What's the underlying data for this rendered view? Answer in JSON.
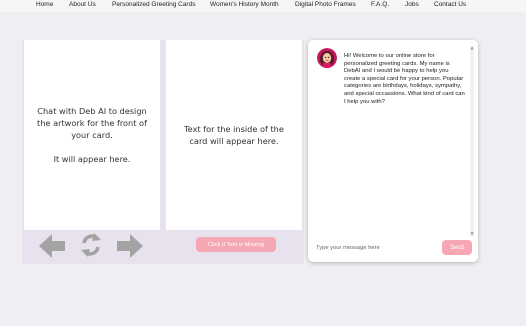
{
  "nav": {
    "items": [
      {
        "label": "Home"
      },
      {
        "label": "About Us"
      },
      {
        "label": "Personalized Greeting Cards"
      },
      {
        "label": "Women's History Month"
      },
      {
        "label": "Digital Photo Frames"
      },
      {
        "label": "F.A.Q."
      },
      {
        "label": "Jobs"
      },
      {
        "label": "Contact Us"
      }
    ]
  },
  "card_front": {
    "text": "Chat with Deb AI to design\nthe artwork for the front of\nyour card.\n\nIt will appear here."
  },
  "card_inside": {
    "text": "Text for the inside of the\ncard will appear here."
  },
  "controls": {
    "back_icon": "arrow-left-icon",
    "refresh_icon": "refresh-icon",
    "forward_icon": "arrow-right-icon",
    "missing_button_label": "Click if Text is Missing"
  },
  "chat": {
    "avatar_icon": "assistant-avatar",
    "welcome_message": "Hi! Welcome to our online store for personalized greeting cards. My name is DebAI and I would be happy to help you create a special card for your person. Popular categories are birthdays, holidays, sympathy, and special occassions. What kind of card can I help you with?",
    "input_placeholder": "Type your message here",
    "send_label": "Send"
  },
  "colors": {
    "accent_pink": "#f6a7b4",
    "panel_bg": "#e7e2ee",
    "icon_gray": "#a3a3a3"
  }
}
